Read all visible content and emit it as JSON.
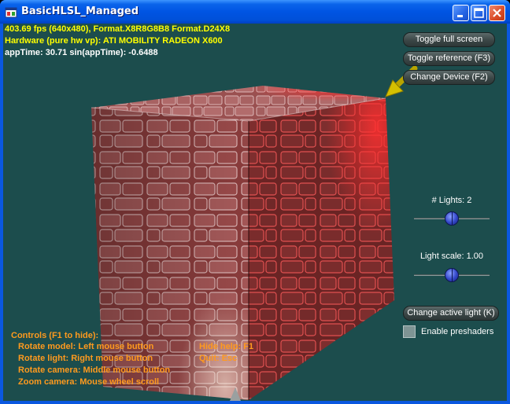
{
  "window": {
    "title": "BasicHLSL_Managed",
    "accent": "#0054e3",
    "client_bg": "#1c4d4d"
  },
  "stats": {
    "line1": "403.69 fps (640x480), Format.X8R8G8B8 Format.D24X8",
    "line2": "Hardware (pure hw vp): ATI MOBILITY RADEON X600",
    "line3": "appTime: 30.71 sin(appTime): -0.6488"
  },
  "buttons": {
    "toggle_full_screen": "Toggle full screen",
    "toggle_reference": "Toggle reference (F3)",
    "change_device": "Change Device (F2)",
    "change_active_light": "Change active light (K)"
  },
  "sliders": {
    "lights_label": "# Lights: 2",
    "lights_value": 0.5,
    "light_scale_label": "Light scale: 1.00",
    "light_scale_value": 0.5
  },
  "checkbox": {
    "enable_preshaders_label": "Enable preshaders",
    "enable_preshaders_checked": false
  },
  "help": {
    "title": "Controls (F1 to hide):",
    "rotate_model": "Rotate model: Left mouse button",
    "rotate_light": "Rotate light: Right mouse button",
    "rotate_camera": "Rotate camera: Middle mouse button",
    "zoom_camera": "Zoom camera: Mouse wheel scroll",
    "hide_help": "Hide help: F1",
    "quit": "Quit: Esc"
  },
  "colors": {
    "stats_text": "#ffff00",
    "help_text": "#ff9a1e",
    "cube_base": "#8a3a3a",
    "light_arrow": "#c8b400"
  },
  "icons": {
    "app": "app-window-icon",
    "minimize": "minimize-icon",
    "maximize": "maximize-icon",
    "close": "close-icon"
  }
}
